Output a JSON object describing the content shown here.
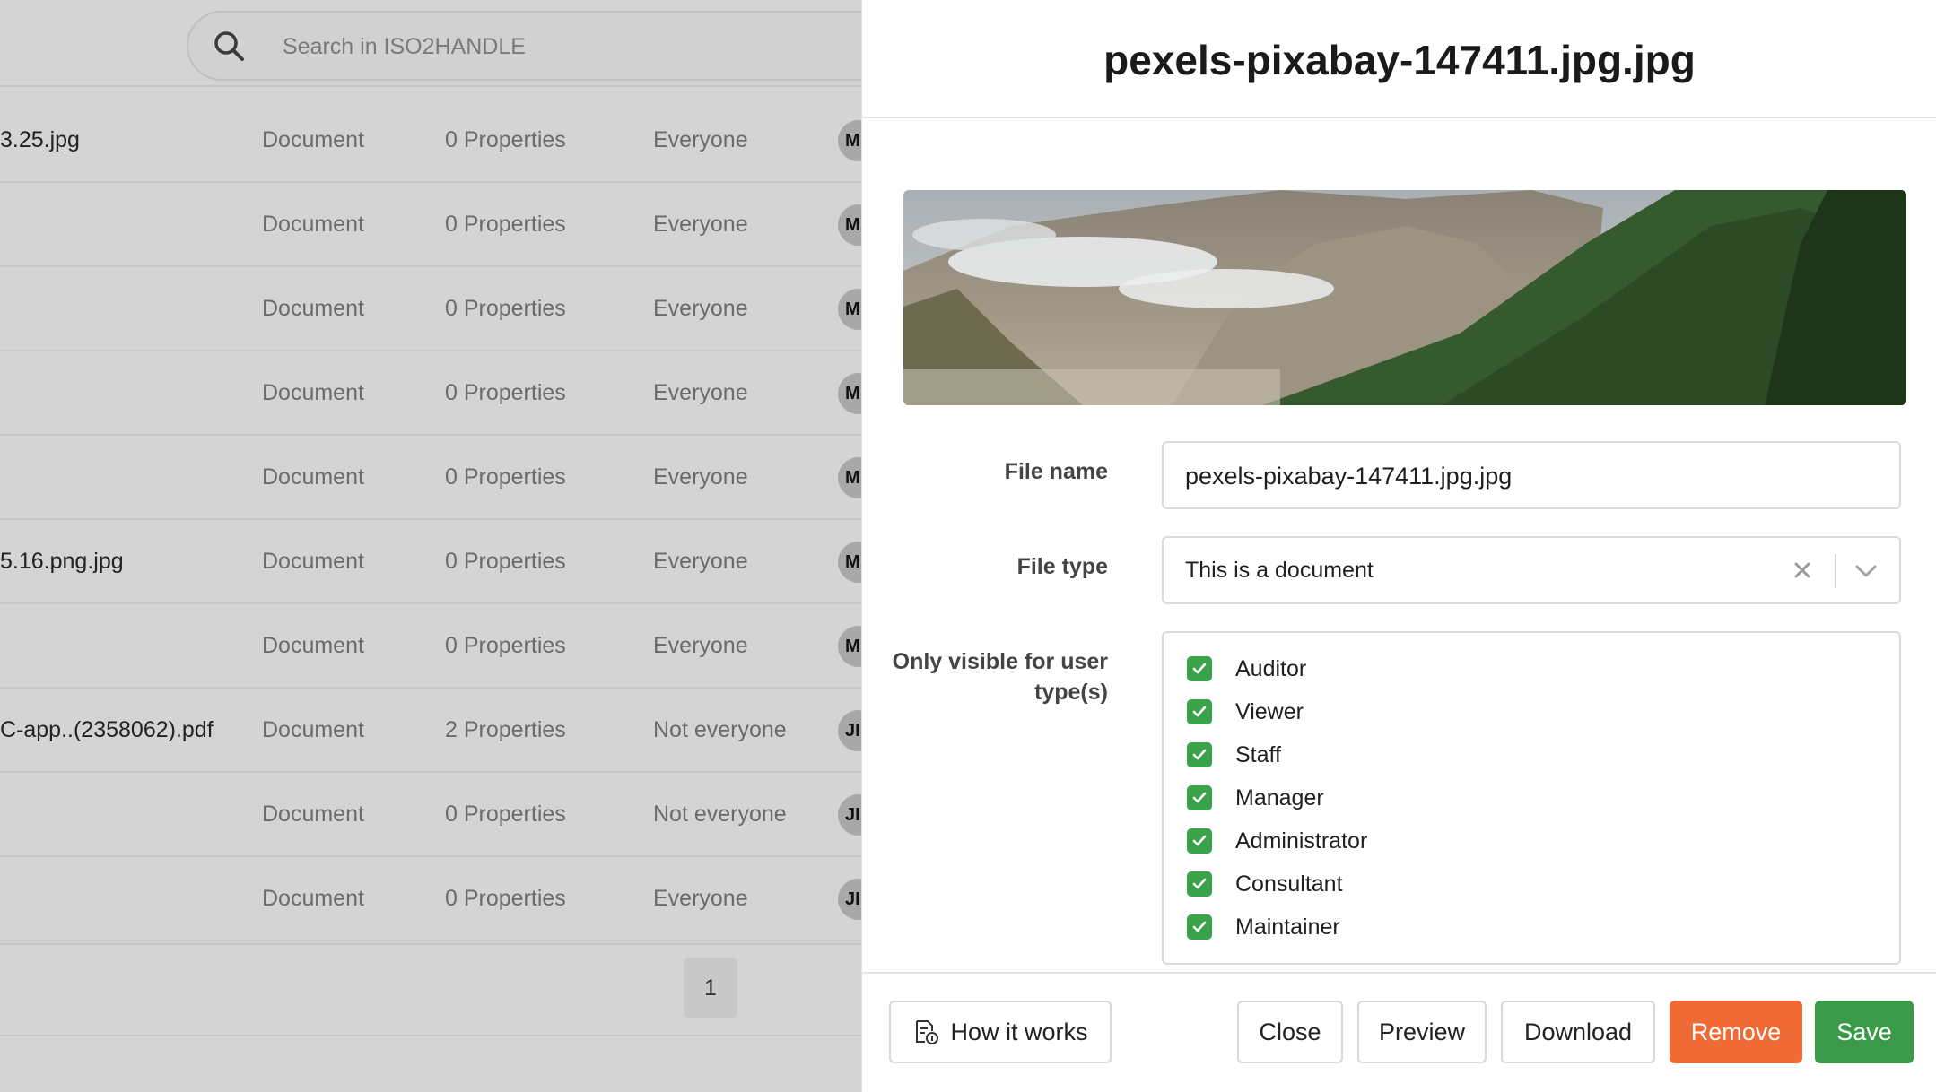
{
  "search": {
    "placeholder": "Search in ISO2HANDLE"
  },
  "rows": [
    {
      "name": "3.25.jpg",
      "type": "Document",
      "properties": "0 Properties",
      "visibility": "Everyone",
      "avatar": "M"
    },
    {
      "name": "",
      "type": "Document",
      "properties": "0 Properties",
      "visibility": "Everyone",
      "avatar": "M"
    },
    {
      "name": "",
      "type": "Document",
      "properties": "0 Properties",
      "visibility": "Everyone",
      "avatar": "M"
    },
    {
      "name": "",
      "type": "Document",
      "properties": "0 Properties",
      "visibility": "Everyone",
      "avatar": "M"
    },
    {
      "name": "",
      "type": "Document",
      "properties": "0 Properties",
      "visibility": "Everyone",
      "avatar": "M"
    },
    {
      "name": "5.16.png.jpg",
      "type": "Document",
      "properties": "0 Properties",
      "visibility": "Everyone",
      "avatar": "M"
    },
    {
      "name": "",
      "type": "Document",
      "properties": "0 Properties",
      "visibility": "Everyone",
      "avatar": "M"
    },
    {
      "name": "C-app..(2358062).pdf",
      "type": "Document",
      "properties": "2 Properties",
      "visibility": "Not everyone",
      "avatar": "JI"
    },
    {
      "name": "",
      "type": "Document",
      "properties": "0 Properties",
      "visibility": "Not everyone",
      "avatar": "JI"
    },
    {
      "name": "",
      "type": "Document",
      "properties": "0 Properties",
      "visibility": "Everyone",
      "avatar": "JI"
    }
  ],
  "pagination": {
    "current": "1"
  },
  "panel": {
    "title": "pexels-pixabay-147411.jpg.jpg",
    "file_name_label": "File name",
    "file_name_value": "pexels-pixabay-147411.jpg.jpg",
    "file_type_label": "File type",
    "file_type_value": "This is a document",
    "visible_label_line1": "Only visible for user",
    "visible_label_line2": "type(s)",
    "user_types": [
      {
        "label": "Auditor",
        "checked": true
      },
      {
        "label": "Viewer",
        "checked": true
      },
      {
        "label": "Staff",
        "checked": true
      },
      {
        "label": "Manager",
        "checked": true
      },
      {
        "label": "Administrator",
        "checked": true
      },
      {
        "label": "Consultant",
        "checked": true
      },
      {
        "label": "Maintainer",
        "checked": true
      }
    ]
  },
  "buttons": {
    "how_it_works": "How it works",
    "close": "Close",
    "preview": "Preview",
    "download": "Download",
    "remove": "Remove",
    "save": "Save"
  },
  "colors": {
    "remove": "#ef6a35",
    "save": "#3a9a49",
    "checkbox": "#3aa24a"
  },
  "icons": [
    "search-icon",
    "clear-icon",
    "chevron-down-icon",
    "check-icon",
    "document-info-icon"
  ]
}
